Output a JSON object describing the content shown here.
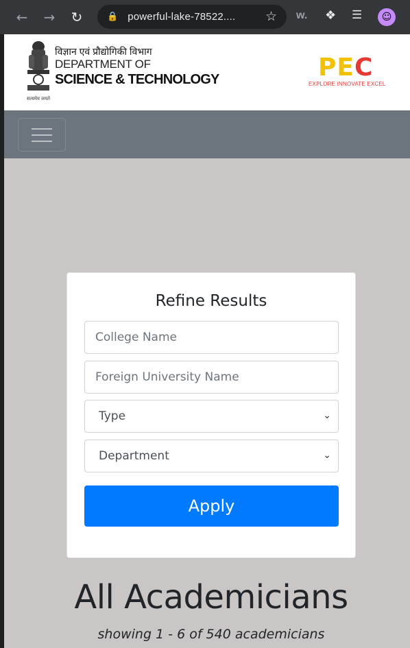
{
  "browser": {
    "url": "powerful-lake-78522....",
    "extensions": [
      "w."
    ]
  },
  "brand": {
    "hindi_title": "विज्ञान एवं प्रौद्योगिकी विभाग",
    "dept_line1": "DEPARTMENT OF",
    "dept_line2": "SCIENCE & TECHNOLOGY",
    "emblem_motto": "सत्यमेव जयते",
    "pec_logo_p_e": "PE",
    "pec_logo_c": "C",
    "pec_tagline": "EXPLORE INNOVATE EXCEL"
  },
  "filter": {
    "title": "Refine Results",
    "college_placeholder": "College Name",
    "foreign_placeholder": "Foreign University Name",
    "type_selected": "Type",
    "department_selected": "Department",
    "apply_label": "Apply"
  },
  "results": {
    "heading": "All Academicians",
    "summary": "showing 1 - 6 of 540 academicians"
  },
  "colors": {
    "primary": "#007bff",
    "navbar": "#6c757d",
    "page_bg": "#cac6c5"
  }
}
